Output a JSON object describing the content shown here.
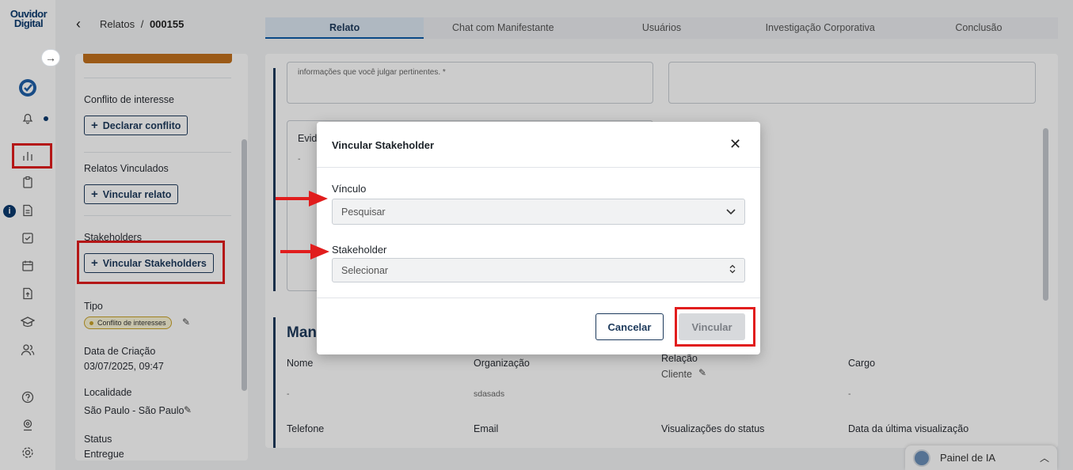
{
  "brand": {
    "logo_line1": "Ouvidor",
    "logo_line2": "Digital"
  },
  "sidebar": {
    "icons": [
      "badge-logo-icon",
      "bell-icon",
      "chart-icon",
      "clipboard-icon",
      "document-icon",
      "checkbox-icon",
      "calendar-icon",
      "file-upload-icon",
      "graduation-icon",
      "users-icon",
      "help-icon",
      "location-icon",
      "settings-icon"
    ],
    "info_badge": "i"
  },
  "header": {
    "back_symbol": "‹",
    "breadcrumb_parent": "Relatos",
    "breadcrumb_sep": "/",
    "breadcrumb_current": "000155"
  },
  "tabs": [
    "Relato",
    "Chat com Manifestante",
    "Usuários",
    "Investigação Corporativa",
    "Conclusão"
  ],
  "left_panel": {
    "conflict_label": "Conflito de interesse",
    "conflict_button": "Declarar conflito",
    "linked_label": "Relatos Vinculados",
    "linked_button": "Vincular relato",
    "stakeholders_label": "Stakeholders",
    "stakeholders_button": "Vincular Stakeholders",
    "type_label": "Tipo",
    "type_value": "Conflito de interesses",
    "created_label": "Data de Criação",
    "created_value": "03/07/2025, 09:47",
    "location_label": "Localidade",
    "location_value": "São Paulo - São Paulo",
    "status_label": "Status",
    "status_value": "Entregue"
  },
  "main": {
    "hint_text": "informações que você julgar pertinentes. *",
    "evidence_partial": "Evid",
    "evidence_value": "-",
    "section_title_partial": "Man",
    "row1_labels": [
      "Nome",
      "Organização",
      "Relação",
      "Cargo"
    ],
    "row1_values": [
      "-",
      "sdasads",
      "Cliente",
      "-"
    ],
    "row2_labels": [
      "Telefone",
      "Email",
      "Visualizações do status",
      "Data da última visualização"
    ]
  },
  "modal": {
    "title": "Vincular Stakeholder",
    "close_symbol": "✕",
    "vinculo_label": "Vínculo",
    "vinculo_placeholder": "Pesquisar",
    "stakeholder_label": "Stakeholder",
    "stakeholder_placeholder": "Selecionar",
    "cancel_label": "Cancelar",
    "submit_label": "Vincular"
  },
  "ai_panel": {
    "label": "Painel de IA"
  },
  "colors": {
    "annotation_red": "#e11d1d",
    "brand_navy": "#1d3a5c",
    "accent_orange": "#c2711d"
  }
}
